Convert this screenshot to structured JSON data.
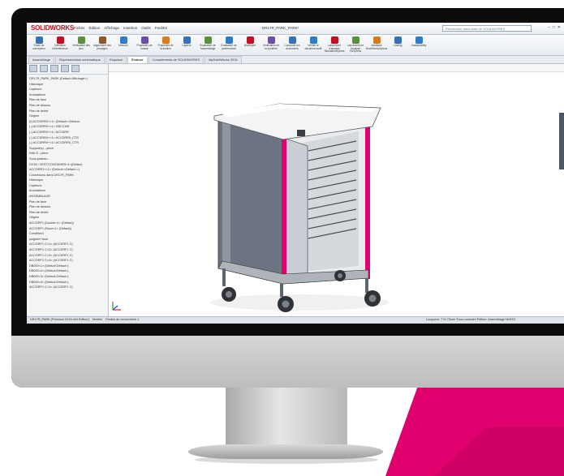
{
  "app": {
    "logo": "SOLIDWORKS",
    "menus": [
      "Fichier",
      "Édition",
      "Affichage",
      "Insertion",
      "Outils",
      "Fenêtre"
    ],
    "document_title": "DR17R_PARK_PARK*",
    "search_placeholder": "Rechercher dans Aide de SOLIDWORKS"
  },
  "ribbon": {
    "buttons": [
      {
        "label": "Étude de concepteur",
        "icon": "study-icon"
      },
      {
        "label": "Définition d'interférence",
        "icon": "interference-icon"
      },
      {
        "label": "Vérification des jeux",
        "icon": "clearance-icon"
      },
      {
        "label": "Alignement des perçages",
        "icon": "hole-align-icon"
      },
      {
        "label": "Mesurer",
        "icon": "measure-icon"
      },
      {
        "label": "Propriétés de masse",
        "icon": "mass-icon"
      },
      {
        "label": "Propriétés de la section",
        "icon": "section-icon"
      },
      {
        "label": "Capteur",
        "icon": "sensor-icon"
      },
      {
        "label": "Évaluation de l'assemblage",
        "icon": "eval-icon"
      },
      {
        "label": "Évaluation de performance",
        "icon": "perf-icon"
      },
      {
        "label": "DraftXpert",
        "icon": "draft-icon"
      },
      {
        "label": "Vérification de la symétrie",
        "icon": "symmetry-icon"
      },
      {
        "label": "Comparer les documents",
        "icon": "compare-icon"
      },
      {
        "label": "Vérifier le document actif",
        "icon": "check-icon"
      },
      {
        "label": "Lancement d'analyse SimulationXpress",
        "icon": "sim-icon"
      },
      {
        "label": "Lancement de l'analyse FloXpress",
        "icon": "flow-icon"
      },
      {
        "label": "Assistant DriveWorksXpress",
        "icon": "drive-icon"
      },
      {
        "label": "Costing",
        "icon": "cost-icon"
      },
      {
        "label": "Sustainability",
        "icon": "sustain-icon"
      }
    ]
  },
  "cmd_tabs": [
    "Assemblage",
    "Représentation schématique",
    "Esquisse",
    "Évaluer",
    "Compléments de SOLIDWORKS",
    "MySolidWorks 2016"
  ],
  "cmd_tab_active": 3,
  "feature_tree": {
    "items": [
      "DR17R_PARK_PARK (Défaut<Affichage>)",
      "Historique",
      "Capteurs",
      "Annotations",
      "Plan de face",
      "Plan de dessus",
      "Plan de droite",
      "Origine",
      "(f) ACCDRR0+<1> (Défaut<<Défaut>",
      "(-) ACCDRR0+<1> ÜBCCMH",
      "(-) ACCDRR0+<1> ACCDRR",
      "(-) ACCDRR0+<1> ACCDRR0_CTR",
      "(-) ACCDRR0+<1> ACCDRR0_CTR",
      "Support(s) - pièce",
      "RAILS - pièce",
      "Sous-plateau...",
      "DV18 / VEST.CONTAINER<1>(Défaut)",
      "ACCDRR1+<1> (Défaut<<Défaut>>)",
      "Connexions dans DR17R_PARK",
      "Historique",
      "Capteurs",
      "Annotations",
      "ASSEMBLAGE",
      "Plan de face",
      "Plan de dessus",
      "Plan de droite",
      "Origine",
      "ACCDRF1 (Double<1> (Défaut))",
      "ACCDRF1 (Roue<1> (Défaut))",
      "Condition1",
      "poignée+roue",
      "ACCDRF1 C<1> (ACCDRF1 C)",
      "ACCDRF1 C<2> (ACCDRF1 C)",
      "ACCDRF1 C<3> (ACCDRF1 C)",
      "ACCDRF1 C<4> (ACCDRF1 C)",
      "DB000<1> (Défaut<Défaut>)",
      "DB000<2> (Défaut<Défaut>)",
      "DB000<3> (Défaut<Défaut>)",
      "DB000<4> (Défaut<Défaut>)",
      "ACCDRF1 C<1> (ACCDRF1 C)"
    ]
  },
  "statusbar": {
    "tabs": [
      "Modèle",
      "Études de mouvement 1"
    ],
    "left_text": "DR17R_PARK (Premium 2016 x64 Édition)",
    "right_text": "Longueur: 774.75mm   Sous-contraint   Édition: Assemblage   MMGS"
  },
  "colors": {
    "accent_pink": "#e0006e",
    "sw_red": "#c1121f",
    "cart_grey": "#4b5662"
  }
}
